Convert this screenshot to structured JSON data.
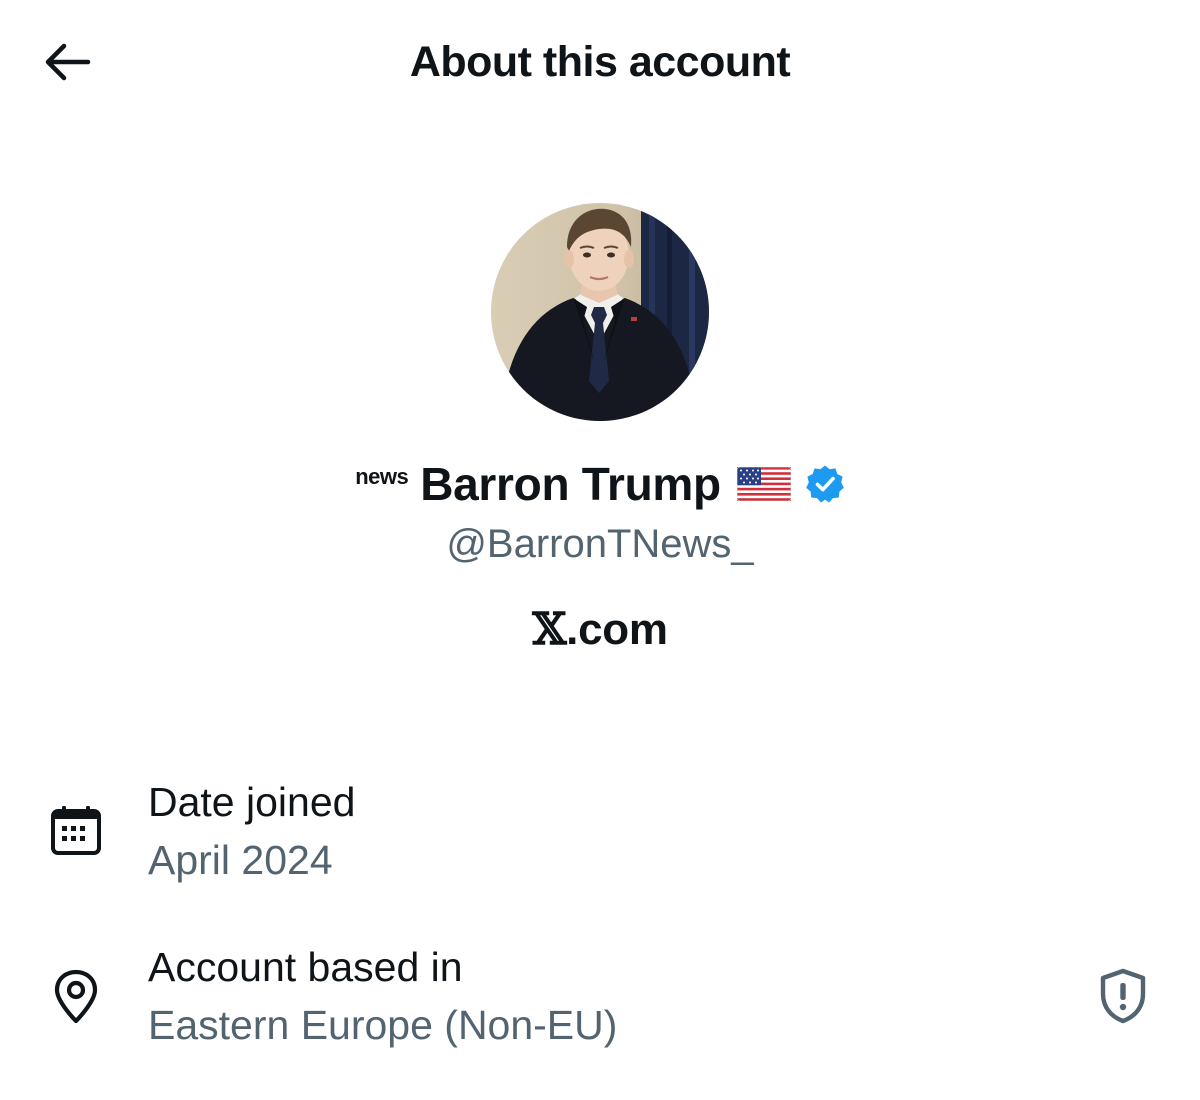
{
  "header": {
    "title": "About this account",
    "back_icon": "arrow-left-icon"
  },
  "profile": {
    "affiliate_badge": "news",
    "display_name": "Barron Trump",
    "flag": "🇺🇸",
    "verified": true,
    "handle": "@BarronTNews_",
    "platform_symbol": "𝕏",
    "platform_suffix": ".com"
  },
  "details": [
    {
      "icon": "calendar-icon",
      "label": "Date joined",
      "value": "April 2024"
    },
    {
      "icon": "location-pin-icon",
      "label": "Account based in",
      "value": "Eastern Europe (Non-EU)",
      "action_icon": "shield-alert-icon"
    }
  ],
  "colors": {
    "text_primary": "#0f1419",
    "text_secondary": "#536471",
    "verified_blue": "#1d9bf0",
    "background": "#ffffff"
  }
}
